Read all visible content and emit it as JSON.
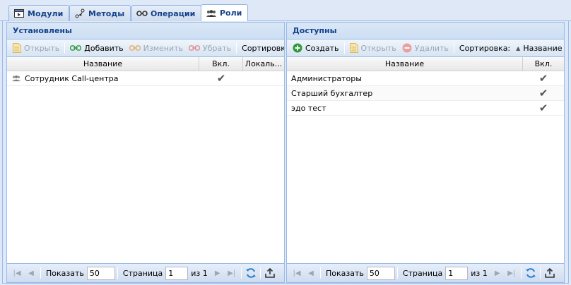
{
  "tabs": [
    {
      "label": "Модули",
      "icon": "module-icon",
      "active": false
    },
    {
      "label": "Методы",
      "icon": "methods-icon",
      "active": false
    },
    {
      "label": "Операции",
      "icon": "operations-icon",
      "active": false
    },
    {
      "label": "Роли",
      "icon": "roles-icon",
      "active": true
    }
  ],
  "left": {
    "title": "Установлены",
    "toolbar": {
      "open": "Открыть",
      "add": "Добавить",
      "edit": "Изменить",
      "remove": "Убрать",
      "sort_label": "Сортировка:"
    },
    "columns": {
      "name": "Название",
      "enabled": "Вкл.",
      "local": "Локаль..."
    },
    "rows": [
      {
        "name": "Сотрудник Call-центра",
        "enabled": "✔",
        "local": ""
      }
    ],
    "pager": {
      "show_label": "Показать",
      "page_size": "50",
      "page_label": "Страница",
      "page": "1",
      "of_label": "из 1"
    }
  },
  "right": {
    "title": "Доступны",
    "toolbar": {
      "create": "Создать",
      "open": "Открыть",
      "delete": "Удалить",
      "sort_label": "Сортировка:",
      "sort_field": "Название"
    },
    "columns": {
      "name": "Название",
      "enabled": "Вкл."
    },
    "rows": [
      {
        "name": "Администраторы",
        "enabled": "✔"
      },
      {
        "name": "Старший бухгалтер",
        "enabled": "✔"
      },
      {
        "name": "эдо тест",
        "enabled": "✔"
      }
    ],
    "pager": {
      "show_label": "Показать",
      "page_size": "50",
      "page_label": "Страница",
      "page": "1",
      "of_label": "из 1"
    }
  },
  "colors": {
    "accent": "#15428b",
    "border": "#99bbe8",
    "create_green": "#2e9a3a",
    "delete_red": "#d9534f"
  }
}
